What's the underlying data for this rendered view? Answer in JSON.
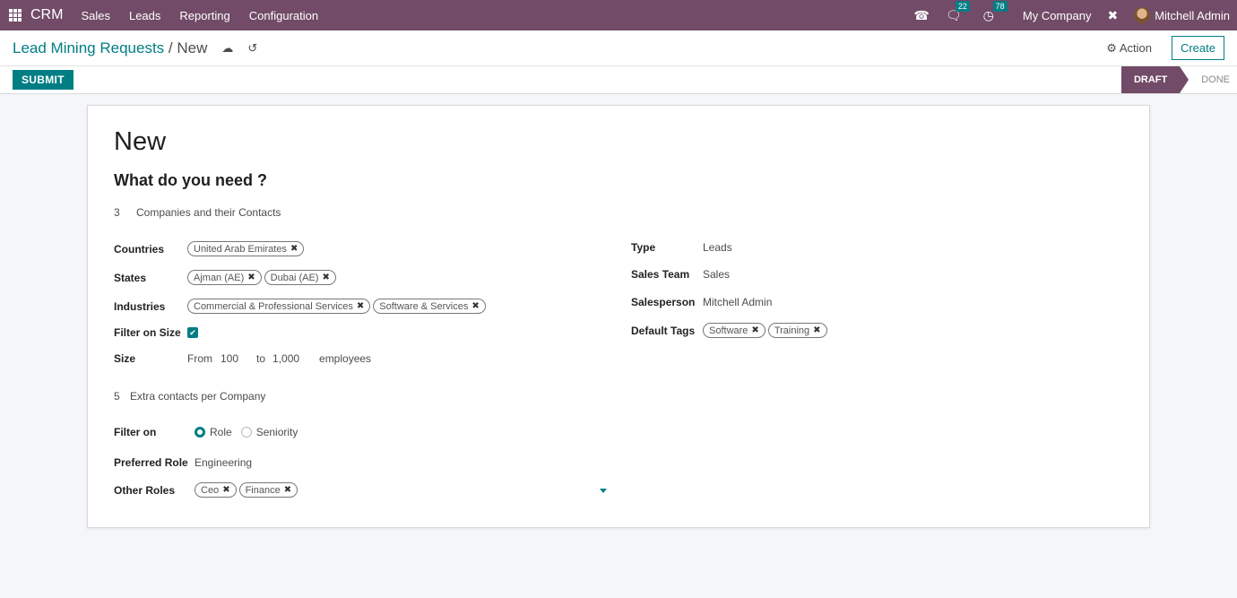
{
  "navbar": {
    "brand": "CRM",
    "menu": [
      "Sales",
      "Leads",
      "Reporting",
      "Configuration"
    ],
    "messages_count": "22",
    "activities_count": "78",
    "company": "My Company",
    "user": "Mitchell Admin"
  },
  "control": {
    "breadcrumb_parent": "Lead Mining Requests",
    "breadcrumb_sep": "/",
    "breadcrumb_current": "New",
    "action_label": "Action",
    "create_label": "Create"
  },
  "statusbar": {
    "submit_label": "SUBMIT",
    "stages": [
      "DRAFT",
      "DONE"
    ],
    "active_stage": "DRAFT"
  },
  "form": {
    "title": "New",
    "subtitle": "What do you need ?",
    "company_count": "3",
    "company_count_label": "Companies and their Contacts",
    "left": {
      "countries_label": "Countries",
      "countries": [
        "United Arab Emirates"
      ],
      "states_label": "States",
      "states": [
        "Ajman (AE)",
        "Dubai (AE)"
      ],
      "industries_label": "Industries",
      "industries": [
        "Commercial & Professional Services",
        "Software & Services"
      ],
      "filter_size_label": "Filter on Size",
      "filter_size_checked": true,
      "size_label": "Size",
      "size_from_label": "From",
      "size_from": "100",
      "size_to_label": "to",
      "size_to": "1,000",
      "size_unit": "employees"
    },
    "right": {
      "type_label": "Type",
      "type": "Leads",
      "team_label": "Sales Team",
      "team": "Sales",
      "salesperson_label": "Salesperson",
      "salesperson": "Mitchell Admin",
      "tags_label": "Default Tags",
      "tags": [
        "Software",
        "Training"
      ]
    },
    "contacts_count": "5",
    "contacts_label": "Extra contacts per Company",
    "filter_on_label": "Filter on",
    "filter_on_options": [
      "Role",
      "Seniority"
    ],
    "filter_on_selected": "Role",
    "preferred_role_label": "Preferred Role",
    "preferred_role": "Engineering",
    "other_roles_label": "Other Roles",
    "other_roles": [
      "Ceo",
      "Finance"
    ]
  }
}
